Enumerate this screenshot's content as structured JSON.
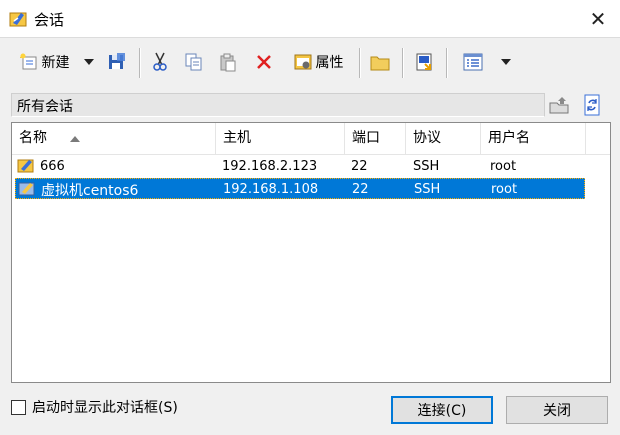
{
  "window": {
    "title": "会话",
    "close_glyph": "✕"
  },
  "toolbar": {
    "new_label": "新建",
    "properties_label": "属性",
    "icons": [
      "new-session-icon",
      "dropdown-arrow-icon",
      "save-icon",
      "cut-icon",
      "copy-icon",
      "paste-icon",
      "delete-icon",
      "properties-icon",
      "folder-icon",
      "shortcut-icon",
      "view-icon",
      "dropdown-arrow-icon"
    ]
  },
  "path_bar": {
    "text": "所有会话"
  },
  "table": {
    "columns": [
      "名称",
      "主机",
      "端口",
      "协议",
      "用户名"
    ],
    "rows": [
      {
        "name": "666",
        "host": "192.168.2.123",
        "port": "22",
        "protocol": "SSH",
        "user": "root",
        "selected": false
      },
      {
        "name": "虚拟机centos6",
        "host": "192.168.1.108",
        "port": "22",
        "protocol": "SSH",
        "user": "root",
        "selected": true
      }
    ]
  },
  "footer": {
    "checkbox_label": "启动时显示此对话框(S)",
    "connect_label": "连接(C)",
    "close_label": "关闭"
  },
  "colors": {
    "selection": "#0078d7",
    "default_button_border": "#0078d7",
    "delete_red": "#e02020"
  }
}
